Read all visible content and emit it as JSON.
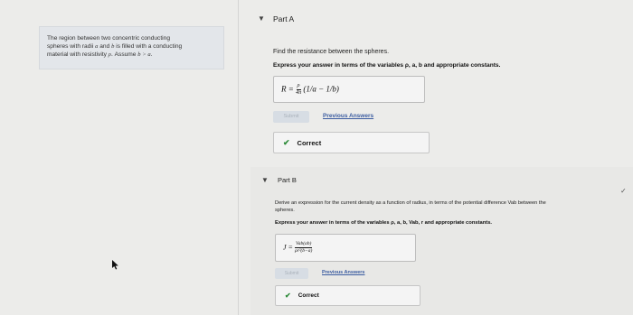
{
  "problem": {
    "statement_line1": "The region between two concentric conducting",
    "statement_line2_pre": "spheres with radii ",
    "var_a": "a",
    "statement_and": " and ",
    "var_b": "b",
    "statement_line2_post": " is filled with a conducting",
    "statement_line3_pre": "material with resistivity ",
    "var_rho": "ρ",
    "statement_line3_mid": ". Assume ",
    "assume": "b > a",
    "period": "."
  },
  "part_a": {
    "title": "Part A",
    "question": "Find the resistance between the spheres.",
    "instruction": "Express your answer in terms of the variables ρ, a, b and appropriate constants.",
    "answer": {
      "lhs": "R =",
      "frac_num": "ρ",
      "frac_den": "4π",
      "inner": "(1/a − 1/b)"
    },
    "submit_label": "Submit",
    "previous_answers": "Previous Answers",
    "feedback": "Correct"
  },
  "part_b": {
    "title": "Part B",
    "question_line1": "Derive an expression for the current density as a function of radius, in terms of the potential difference Vab between the",
    "question_line2": "spheres.",
    "instruction": "Express your answer in terms of the variables ρ, a, b, Vab, r and appropriate constants.",
    "answer": {
      "lhs": "J =",
      "frac_num": "Vab(ab)",
      "frac_den": "ρr²(b−a)"
    },
    "submit_label": "Submit",
    "previous_answers": "Previous Answers",
    "feedback": "Correct"
  }
}
